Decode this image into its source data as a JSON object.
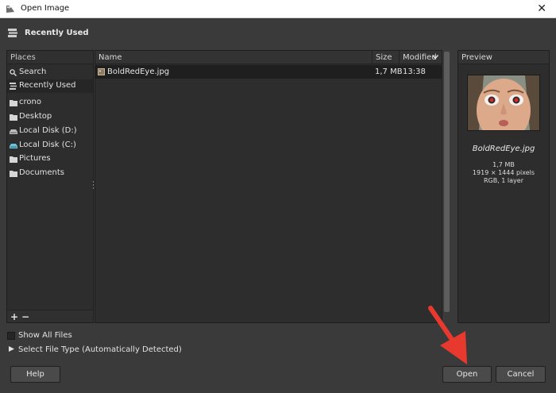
{
  "window": {
    "title": "Open Image",
    "close_glyph": "✕"
  },
  "folder_bar": {
    "label": "Recently Used",
    "icon": "history-icon"
  },
  "places": {
    "header": "Places",
    "items": [
      {
        "label": "Search",
        "icon": "search-icon"
      },
      {
        "label": "Recently Used",
        "icon": "history-icon",
        "selected": true
      },
      {
        "label": "crono",
        "icon": "folder-icon"
      },
      {
        "label": "Desktop",
        "icon": "folder-icon"
      },
      {
        "label": "Local Disk (D:)",
        "icon": "drive-icon"
      },
      {
        "label": "Local Disk (C:)",
        "icon": "drive-icon"
      },
      {
        "label": "Pictures",
        "icon": "folder-icon"
      },
      {
        "label": "Documents",
        "icon": "folder-icon"
      }
    ],
    "add_label": "+",
    "remove_label": "−"
  },
  "files": {
    "columns": {
      "name": "Name",
      "size": "Size",
      "modified": "Modified"
    },
    "rows": [
      {
        "name": "BoldRedEye.jpg",
        "size": "1,7 MB",
        "modified": "13:38",
        "icon": "image-file-icon"
      }
    ]
  },
  "preview": {
    "header": "Preview",
    "filename": "BoldRedEye.jpg",
    "size": "1,7 MB",
    "dimensions": "1919 × 1444 pixels",
    "color_info": "RGB, 1 layer"
  },
  "options": {
    "show_all_files": "Show All Files",
    "select_file_type": "Select File Type (Automatically Detected)"
  },
  "buttons": {
    "help": "Help",
    "open": "Open",
    "cancel": "Cancel"
  },
  "colors": {
    "annotation_arrow": "#e8392e",
    "selection_row": "#1f1f1f"
  }
}
